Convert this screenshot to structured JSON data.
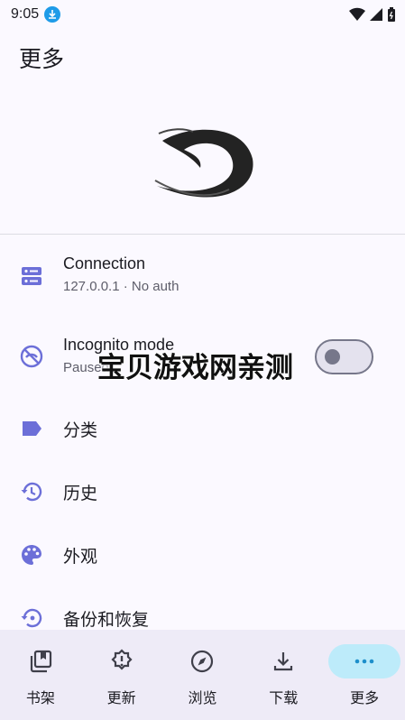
{
  "status": {
    "time": "9:05"
  },
  "header": {
    "title": "更多"
  },
  "connection": {
    "title": "Connection",
    "subtitle": "127.0.0.1 · No auth"
  },
  "incognito": {
    "title": "Incognito mode",
    "subtitle": "Paused",
    "enabled": false
  },
  "menu": [
    {
      "label": "分类",
      "icon": "label-icon"
    },
    {
      "label": "历史",
      "icon": "history-icon"
    },
    {
      "label": "外观",
      "icon": "palette-icon"
    },
    {
      "label": "备份和恢复",
      "icon": "backup-restore-icon"
    }
  ],
  "watermark": {
    "text": "宝贝游戏网亲测"
  },
  "bottom_nav": [
    {
      "label": "书架",
      "icon": "bookshelf-icon",
      "active": false
    },
    {
      "label": "更新",
      "icon": "updates-icon",
      "active": false
    },
    {
      "label": "浏览",
      "icon": "compass-icon",
      "active": false
    },
    {
      "label": "下载",
      "icon": "download-icon",
      "active": false
    },
    {
      "label": "更多",
      "icon": "more-icon",
      "active": true
    }
  ],
  "colors": {
    "accent": "#6C6FD8",
    "background": "#FBF9FF",
    "nav_active": "#BDEBFA"
  }
}
